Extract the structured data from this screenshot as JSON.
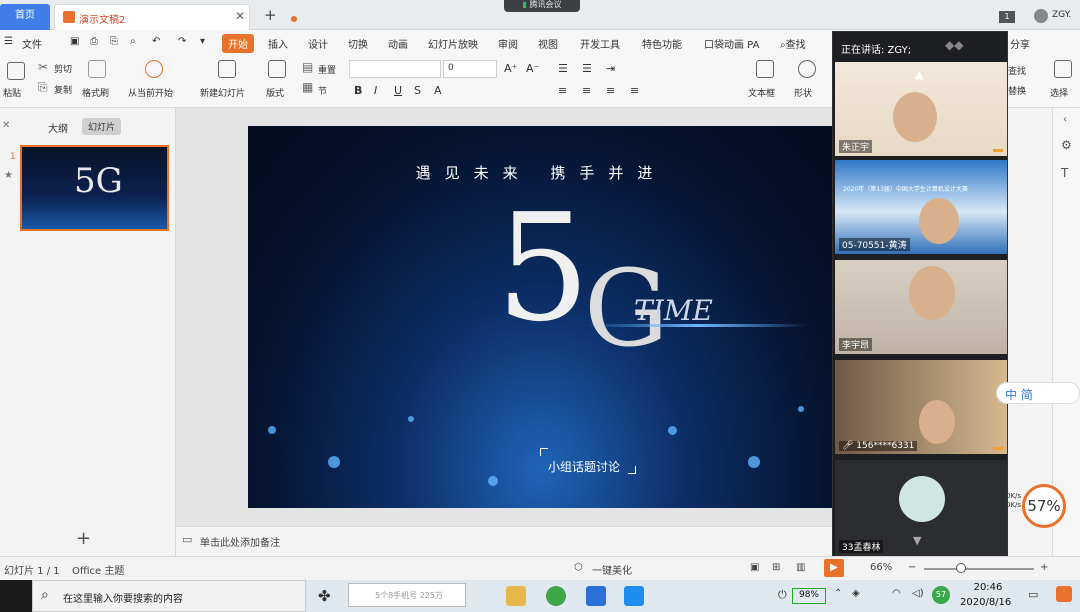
{
  "tabs": {
    "home": "首页",
    "doc": "演示文稿2"
  },
  "meeting_badge": "腾讯会议",
  "window_num": "1",
  "user_name": "ZGY.",
  "menu": [
    "文件",
    "开始",
    "插入",
    "设计",
    "切换",
    "动画",
    "幻灯片放映",
    "审阅",
    "视图",
    "开发工具",
    "特色功能",
    "口袋动画 PA",
    "查找",
    "分享"
  ],
  "ribbon": {
    "paste": "粘贴",
    "cut": "剪切",
    "copy": "复制",
    "format_painter": "格式刷",
    "play_from_current": "从当前开始",
    "new_slide": "新建幻灯片",
    "layout": "版式",
    "reset": "重置",
    "section": "节",
    "font_size_value": "0",
    "textbox": "文本框",
    "shape": "形状",
    "find": "查找",
    "replace": "替换",
    "select": "选择"
  },
  "left_panel": {
    "outline_tab": "大纲",
    "slides_tab": "幻灯片",
    "thumb_number": "1"
  },
  "slide": {
    "heading": "遇见未来 携手并进",
    "big_5": "5",
    "big_g": "G",
    "time": "TIME",
    "topic": "小组话题讨论"
  },
  "notes_placeholder": "单击此处添加备注",
  "meeting": {
    "speaking_label": "正在讲话: ZGY;",
    "participants": [
      {
        "name": "朱正宇"
      },
      {
        "name": "05-70551-黄涛",
        "banner": "2020年（第13届）中国大学生计算机设计大赛"
      },
      {
        "name": "李宇昂"
      },
      {
        "name": "156****6331"
      },
      {
        "name": "33孟春林"
      }
    ]
  },
  "ime": "中 简",
  "gauge_percent": "57%",
  "net_speed": [
    "0K/s",
    "0K/s"
  ],
  "statusbar": {
    "slide_pos": "幻灯片 1 / 1",
    "theme": "Office 主题",
    "beautify": "一键美化",
    "zoom": "66%"
  },
  "taskbar": {
    "search_placeholder": "在这里输入你要搜索的内容",
    "ie_search": "5个8手机号 225万",
    "battery": "98%",
    "notif_count": "57",
    "time": "20:46",
    "date": "2020/8/16"
  }
}
